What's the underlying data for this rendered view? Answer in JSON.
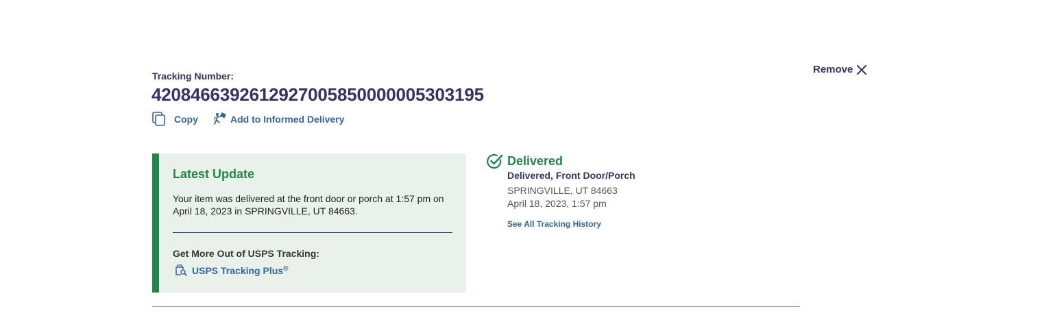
{
  "tracking": {
    "label": "Tracking Number:",
    "number": "420846639261292700585000000530319​5"
  },
  "actions": {
    "copy_label": "Copy",
    "informed_delivery_label": "Add to Informed Delivery",
    "remove_label": "Remove"
  },
  "latest_update": {
    "title": "Latest Update",
    "text": "Your item was delivered at the front door or porch at 1:57 pm on April 18, 2023 in SPRINGVILLE, UT 84663.",
    "more_title": "Get More Out of USPS Tracking:",
    "plus_label": "USPS Tracking Plus",
    "plus_mark": "®"
  },
  "status": {
    "title": "Delivered",
    "subtitle": "Delivered, Front Door/Porch",
    "location": "SPRINGVILLE, UT 84663",
    "datetime": "April 18, 2023, 1:57 pm",
    "history_link": "See All Tracking History"
  },
  "icons": {
    "copy": "copy-icon",
    "informed_delivery": "informed-delivery-icon",
    "remove": "close-icon",
    "delivered": "check-circle-icon",
    "tracking_plus": "tracking-plus-icon"
  },
  "colors": {
    "navy": "#333366",
    "link_blue": "#336699",
    "success_green": "#218748",
    "update_bg": "#eaf1ea"
  }
}
